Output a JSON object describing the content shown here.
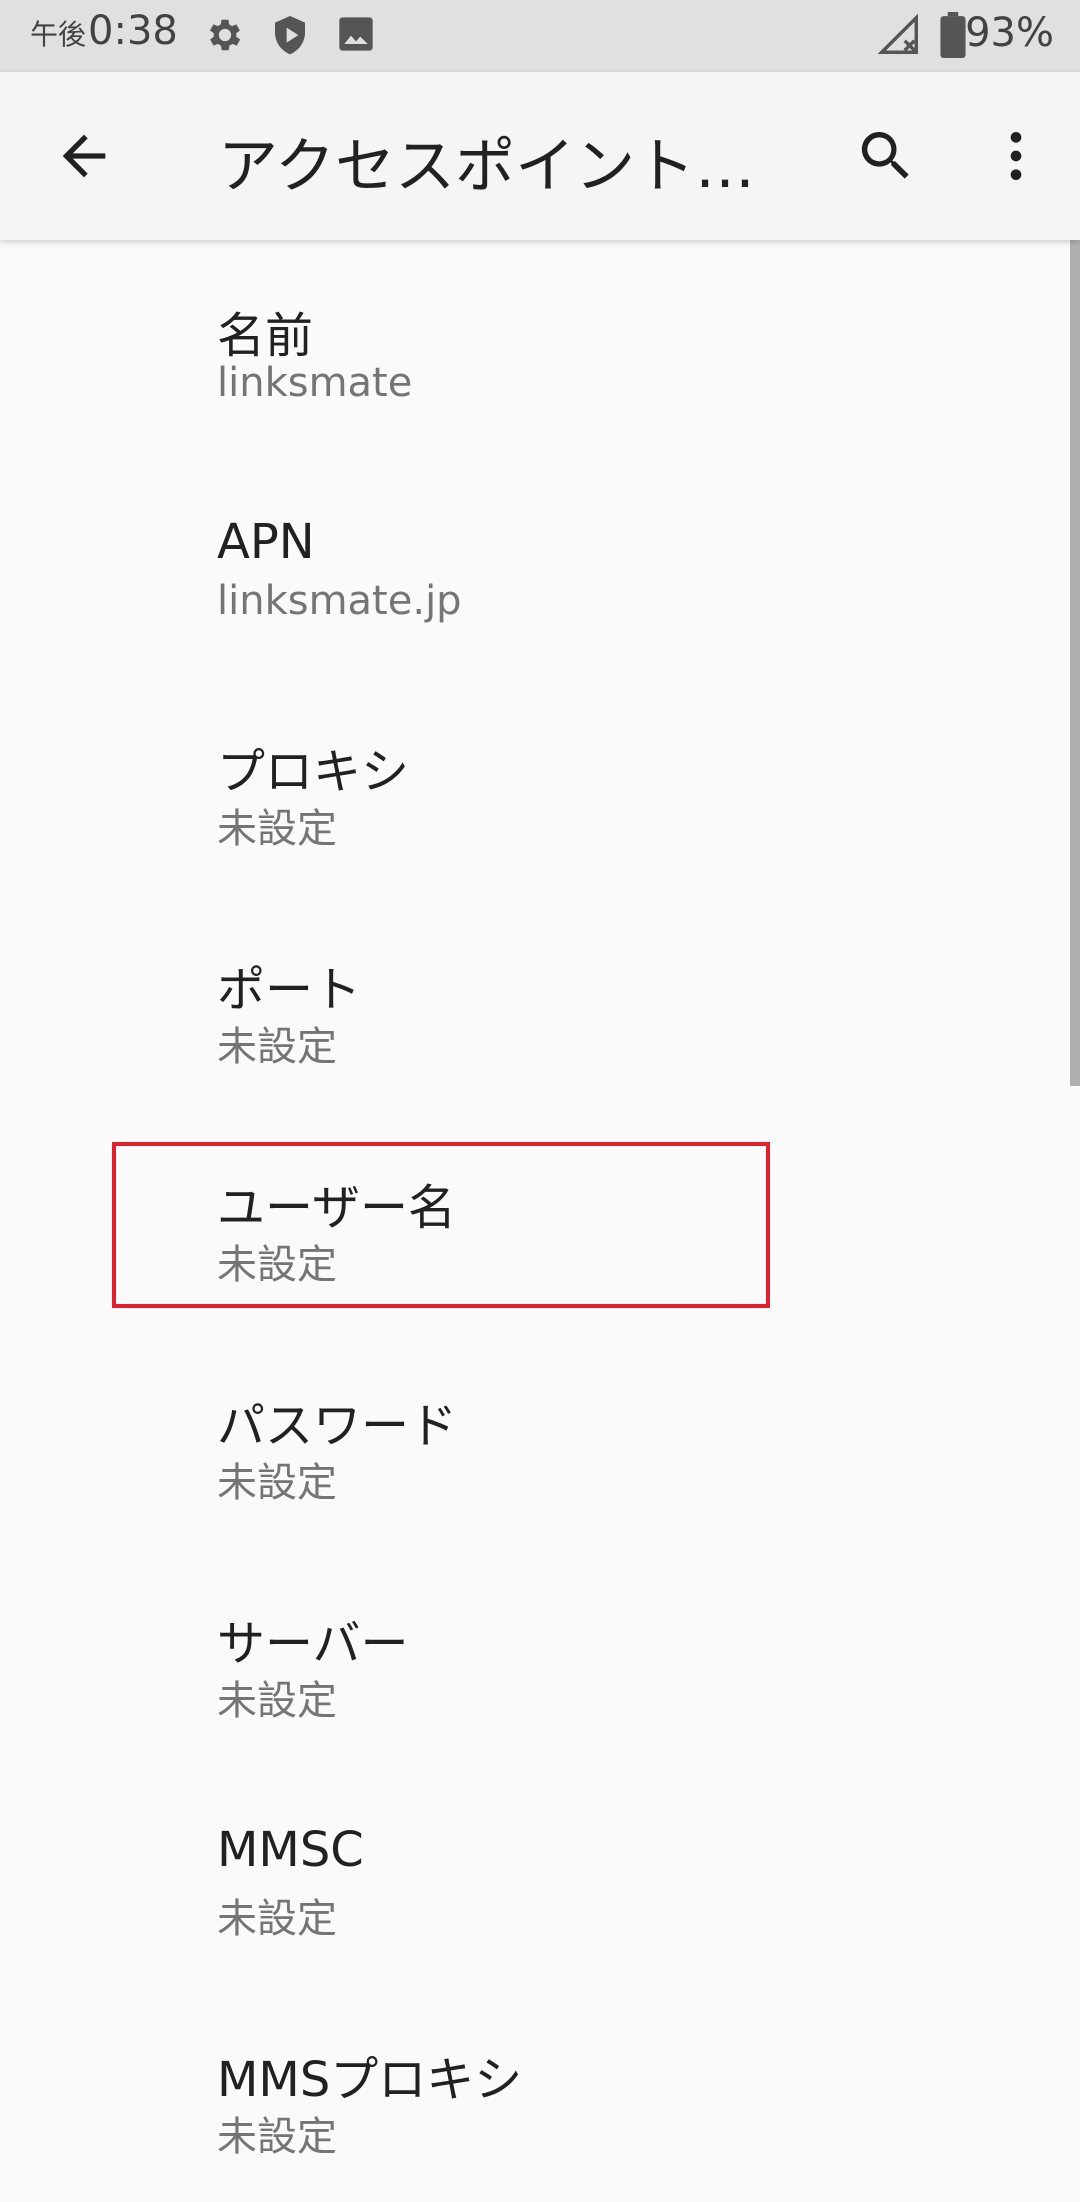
{
  "status_bar": {
    "ampm": "午後",
    "time": "0:38",
    "battery": "93%",
    "icons": [
      "gear-icon",
      "shield-play-icon",
      "image-icon",
      "signal-off-icon",
      "battery-icon"
    ]
  },
  "toolbar": {
    "title": "アクセスポイント…",
    "back_icon": "arrow-back-icon",
    "search_icon": "search-icon",
    "more_icon": "more-vert-icon"
  },
  "settings": [
    {
      "label": "名前",
      "value": "linksmate"
    },
    {
      "label": "APN",
      "value": "linksmate.jp"
    },
    {
      "label": "プロキシ",
      "value": "未設定"
    },
    {
      "label": "ポート",
      "value": "未設定"
    },
    {
      "label": "ユーザー名",
      "value": "未設定"
    },
    {
      "label": "パスワード",
      "value": "未設定"
    },
    {
      "label": "サーバー",
      "value": "未設定"
    },
    {
      "label": "MMSC",
      "value": "未設定"
    },
    {
      "label": "MMSプロキシ",
      "value": "未設定"
    }
  ],
  "colors": {
    "highlight": "#e0202a",
    "background": "#fafafa",
    "secondary_text": "#757575"
  }
}
